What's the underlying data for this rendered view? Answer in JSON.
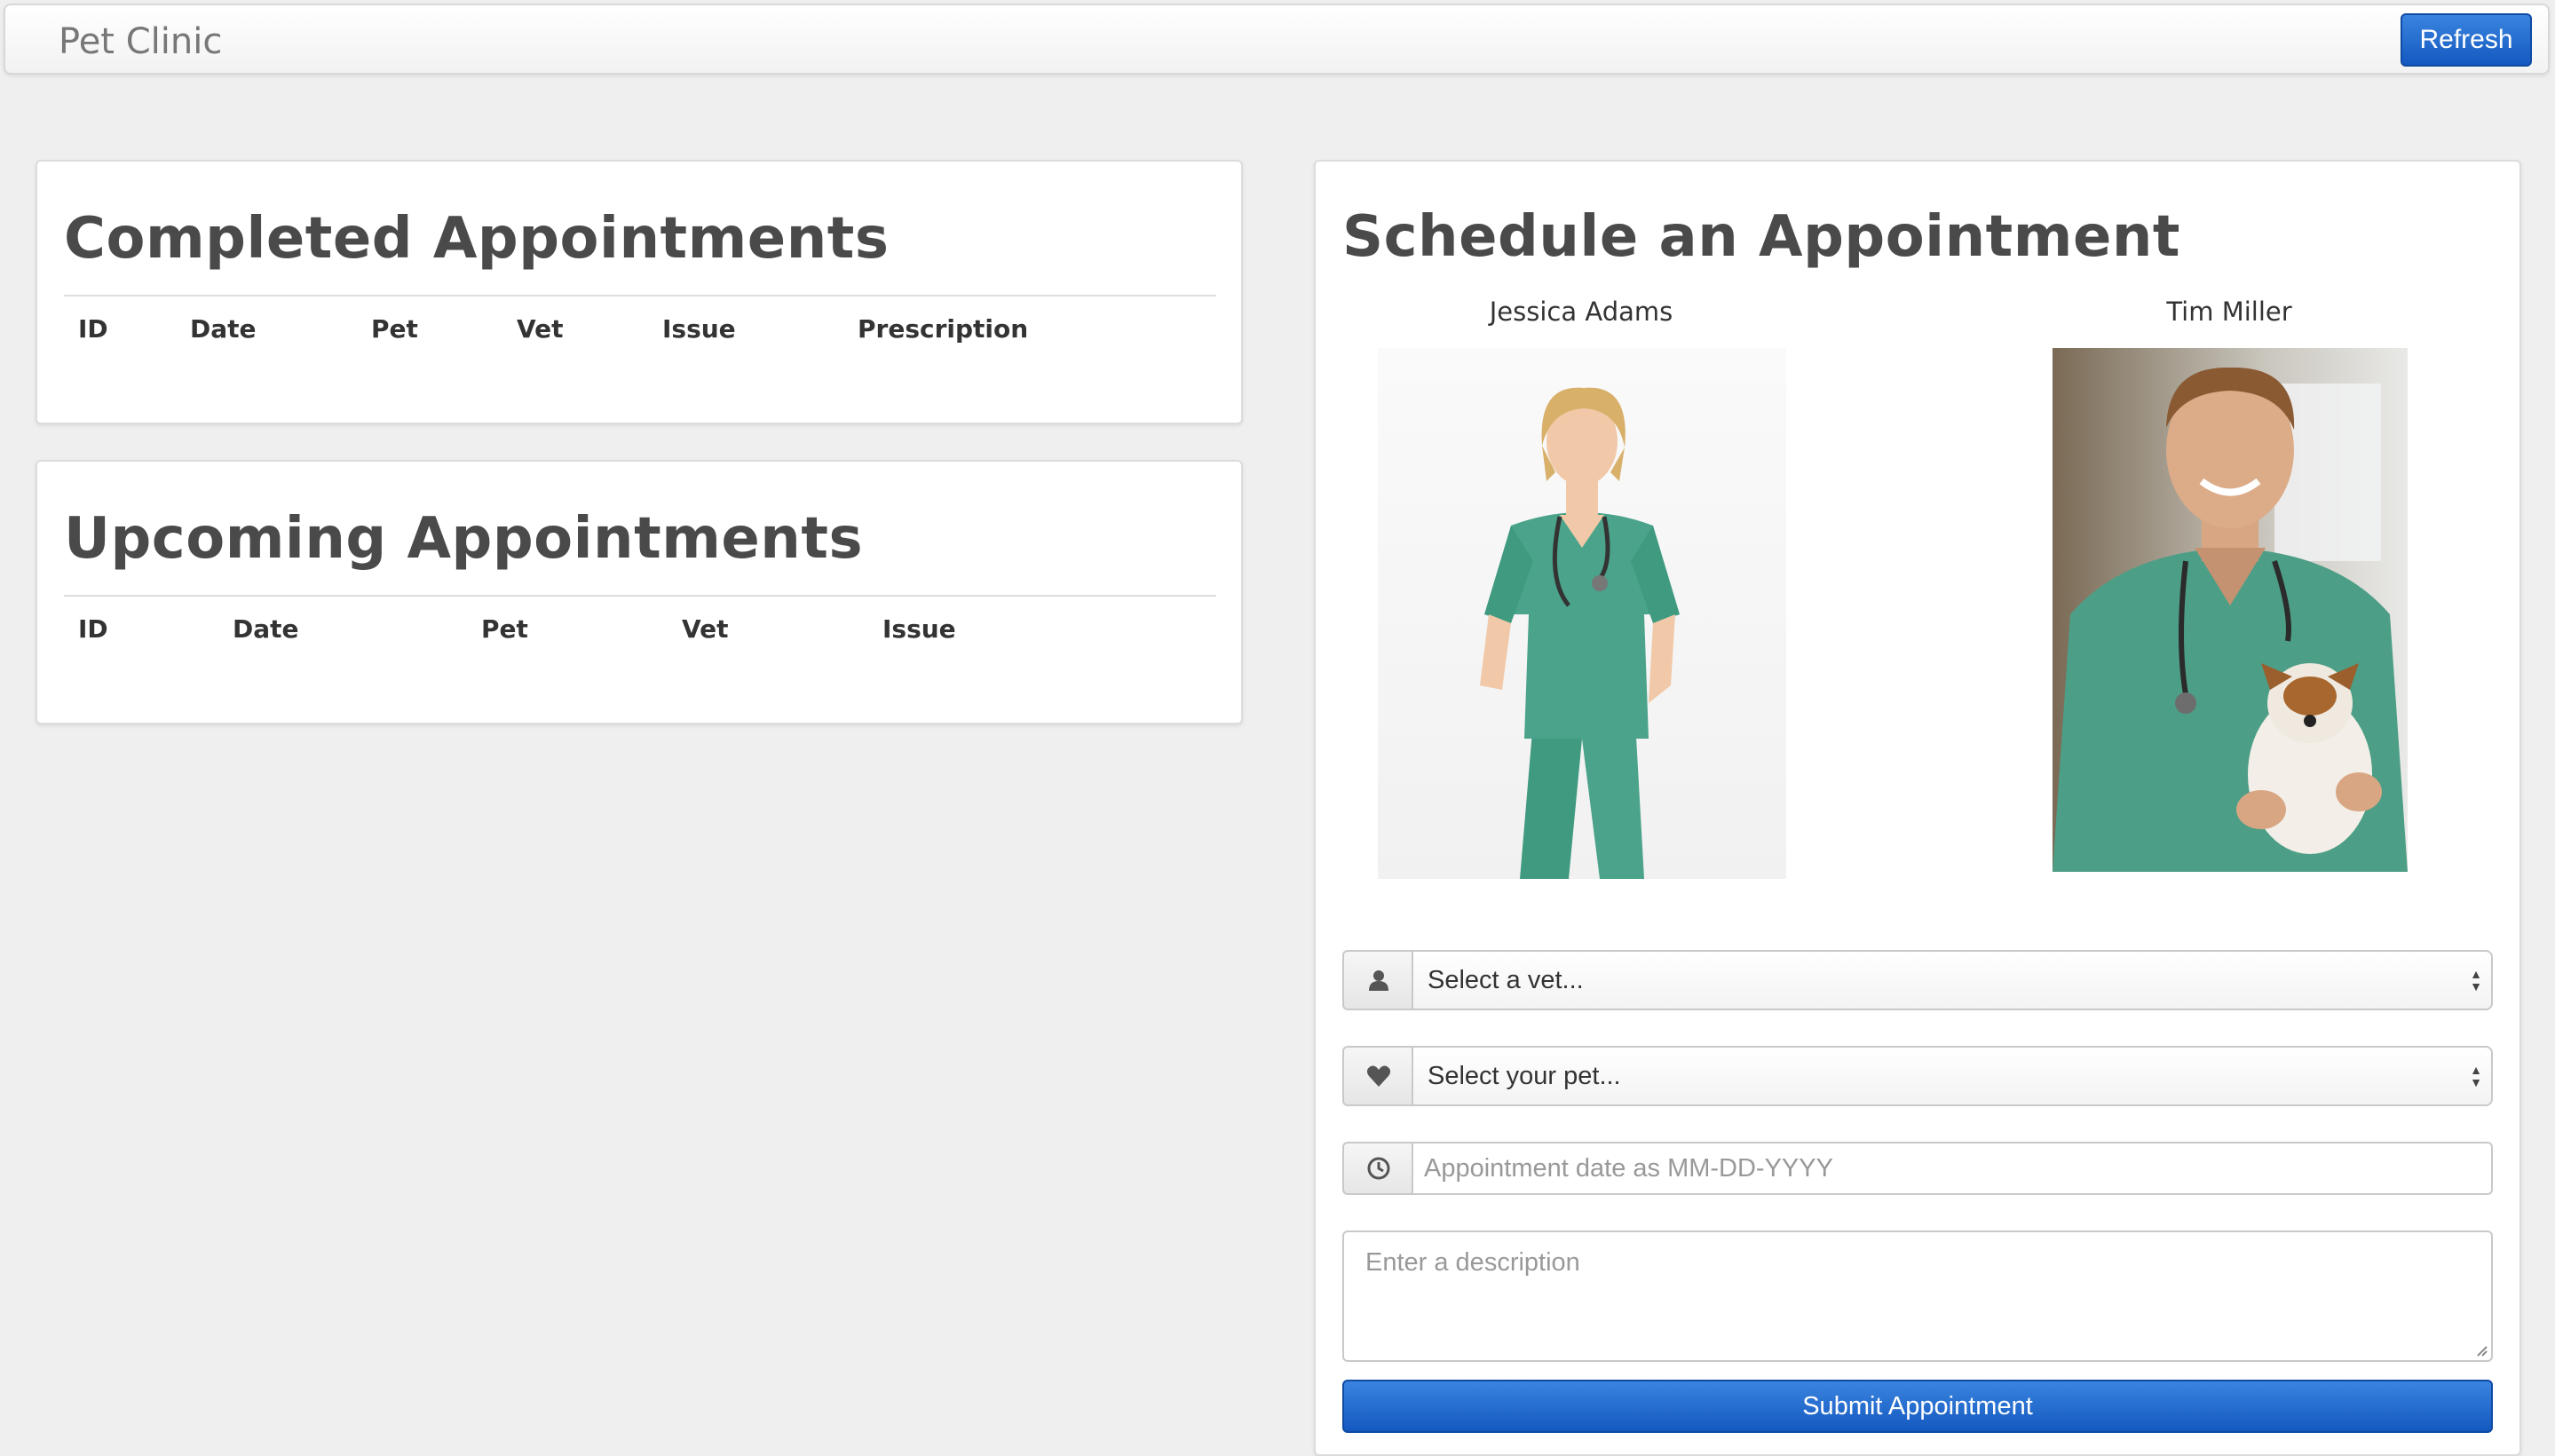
{
  "navbar": {
    "brand": "Pet Clinic",
    "refresh_label": "Refresh"
  },
  "completed": {
    "title": "Completed Appointments",
    "columns": [
      "ID",
      "Date",
      "Pet",
      "Vet",
      "Issue",
      "Prescription"
    ]
  },
  "upcoming": {
    "title": "Upcoming Appointments",
    "columns": [
      "ID",
      "Date",
      "Pet",
      "Vet",
      "Issue"
    ]
  },
  "schedule": {
    "title": "Schedule an Appointment",
    "vets": [
      {
        "name": "Jessica Adams"
      },
      {
        "name": "Tim Miller"
      }
    ],
    "vet_select": {
      "value": "Select a vet...",
      "icon": "user-icon"
    },
    "pet_select": {
      "value": "Select your pet...",
      "icon": "heart-icon"
    },
    "date_input": {
      "placeholder": "Appointment date as MM-DD-YYYY",
      "icon": "clock-icon"
    },
    "description": {
      "placeholder": "Enter a description"
    },
    "submit_label": "Submit Appointment"
  },
  "colors": {
    "primary": "#1c62c9",
    "scrubs": "#4aa38a",
    "background": "#efefef"
  }
}
